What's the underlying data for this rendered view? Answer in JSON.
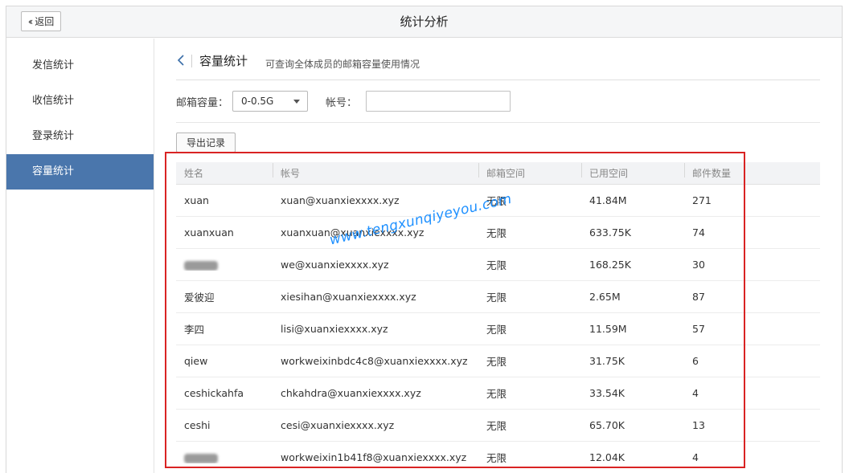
{
  "header": {
    "back_label": "返回",
    "title": "统计分析"
  },
  "sidebar": {
    "items": [
      {
        "label": "发信统计",
        "active": false
      },
      {
        "label": "收信统计",
        "active": false
      },
      {
        "label": "登录统计",
        "active": false
      },
      {
        "label": "容量统计",
        "active": true
      }
    ]
  },
  "page": {
    "title": "容量统计",
    "subtitle": "可查询全体成员的邮箱容量使用情况"
  },
  "filters": {
    "capacity_label": "邮箱容量：",
    "capacity_value": "0-0.5G",
    "account_label": "帐号：",
    "account_value": "",
    "account_placeholder": ""
  },
  "export_label": "导出记录",
  "table": {
    "columns": [
      "姓名",
      "帐号",
      "邮箱空间",
      "已用空间",
      "邮件数量"
    ],
    "rows": [
      {
        "name": "xuan",
        "account": "xuan@xuanxiexxxx.xyz",
        "space": "无限",
        "used": "41.84M",
        "count": "271"
      },
      {
        "name": "xuanxuan",
        "account": "xuanxuan@xuanxiexxxx.xyz",
        "space": "无限",
        "used": "633.75K",
        "count": "74"
      },
      {
        "name": "",
        "account": "we@xuanxiexxxx.xyz",
        "space": "无限",
        "used": "168.25K",
        "count": "30"
      },
      {
        "name": "爱彼迎",
        "account": "xiesihan@xuanxiexxxx.xyz",
        "space": "无限",
        "used": "2.65M",
        "count": "87"
      },
      {
        "name": "李四",
        "account": "lisi@xuanxiexxxx.xyz",
        "space": "无限",
        "used": "11.59M",
        "count": "57"
      },
      {
        "name": "qiew",
        "account": "workweixinbdc4c8@xuanxiexxxx.xyz",
        "space": "无限",
        "used": "31.75K",
        "count": "6"
      },
      {
        "name": "ceshickahfa",
        "account": "chkahdra@xuanxiexxxx.xyz",
        "space": "无限",
        "used": "33.54K",
        "count": "4"
      },
      {
        "name": "ceshi",
        "account": "cesi@xuanxiexxxx.xyz",
        "space": "无限",
        "used": "65.70K",
        "count": "13"
      },
      {
        "name": "",
        "account": "workweixin1b41f8@xuanxiexxxx.xyz",
        "space": "无限",
        "used": "12.04K",
        "count": "4"
      }
    ]
  },
  "watermark": "www.tengxunqiyeyou.com",
  "colors": {
    "sidebar_active": "#4a76ac",
    "highlight_border": "#d92323",
    "watermark": "#1e90ff"
  }
}
